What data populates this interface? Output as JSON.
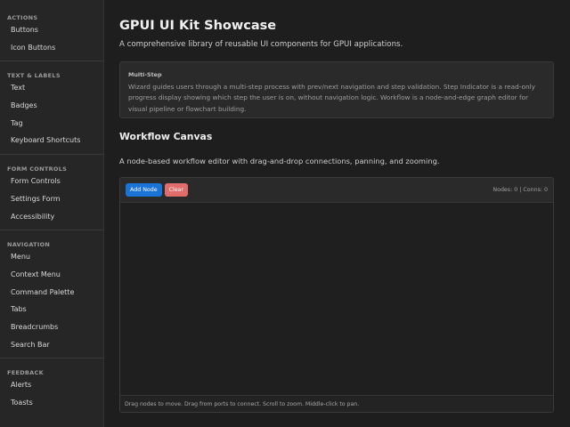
{
  "sidebar": {
    "sections": [
      {
        "title": "ACTIONS",
        "items": [
          "Buttons",
          "Icon Buttons"
        ]
      },
      {
        "title": "TEXT & LABELS",
        "items": [
          "Text",
          "Badges",
          "Tag",
          "Keyboard Shortcuts"
        ]
      },
      {
        "title": "FORM CONTROLS",
        "items": [
          "Form Controls",
          "Settings Form",
          "Accessibility"
        ]
      },
      {
        "title": "NAVIGATION",
        "items": [
          "Menu",
          "Context Menu",
          "Command Palette",
          "Tabs",
          "Breadcrumbs",
          "Search Bar"
        ]
      },
      {
        "title": "FEEDBACK",
        "items": [
          "Alerts",
          "Toasts"
        ]
      }
    ]
  },
  "main": {
    "title": "GPUI UI Kit Showcase",
    "subtitle": "A comprehensive library of reusable UI components for GPUI applications.",
    "info": {
      "title": "Multi-Step",
      "text": "Wizard guides users through a multi-step process with prev/next navigation and step validation. Step Indicator is a read-only progress display showing which step the user is on, without navigation logic. Workflow is a node-and-edge graph editor for visual pipeline or flowchart building."
    },
    "section_title": "Workflow Canvas",
    "section_desc": "A node-based workflow editor with drag-and-drop connections, panning, and zooming.",
    "canvas": {
      "add_label": "Add Node",
      "clear_label": "Clear",
      "stats": "Nodes: 0 | Conns: 0",
      "footer": "Drag nodes to move. Drag from ports to connect. Scroll to zoom. Middle-click to pan."
    }
  },
  "colors": {
    "primary": "#1a73d6",
    "danger": "#e06c6c",
    "background": "#1e1e1e",
    "sidebar": "#262626"
  }
}
